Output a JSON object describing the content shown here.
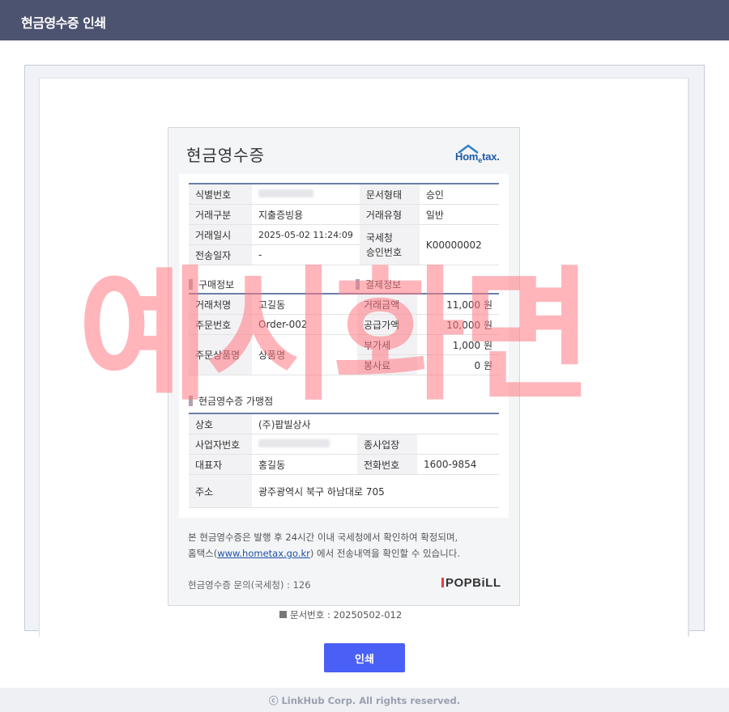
{
  "window": {
    "title": "현금영수증 인쇄"
  },
  "receipt": {
    "title": "현금영수증",
    "logo_text_a": "Hom",
    "logo_text_e": "e",
    "logo_text_b": "tax.",
    "basic": [
      {
        "label": "식별번호",
        "value": "010-****-1234",
        "blurred": true,
        "label2": "문서형태",
        "value2": "승인"
      },
      {
        "label": "거래구분",
        "value": "지출증빙용",
        "label2": "거래유형",
        "value2": "일반"
      },
      {
        "label": "거래일시",
        "value": "2025-05-02 11:24:09",
        "label2": "국세청\n승인번호",
        "value2": "K00000002"
      },
      {
        "label": "전송일자",
        "value": "-"
      }
    ],
    "buyer_section_title": "구매정보",
    "payment_section_title": "결제정보",
    "buyer": [
      {
        "label": "거래처명",
        "value": "고길동"
      },
      {
        "label": "주문번호",
        "value": "Order-002"
      },
      {
        "label": "주문상품명",
        "value": "상품명"
      }
    ],
    "payment": [
      {
        "label": "거래금액",
        "value": "11,000 원"
      },
      {
        "label": "공급가액",
        "value": "10,000 원"
      },
      {
        "label": "부가세",
        "value": "1,000 원"
      },
      {
        "label": "봉사료",
        "value": "0 원"
      }
    ],
    "merchant_section_title": "현금영수증 가맹점",
    "merchant": {
      "name_label": "상호",
      "name": "(주)팝빌상사",
      "bizno_label": "사업자번호",
      "bizno": "678-87-00400",
      "type_label": "종사업장",
      "type": "",
      "ceo_label": "대표자",
      "ceo": "홍길동",
      "tel_label": "전화번호",
      "tel": "1600-9854",
      "addr_label": "주소",
      "addr": "광주광역시 북구 하남대로 705"
    },
    "notice_line1": "본 현금영수증은 발행 후 24시간 이내 국세청에서 확인하여 확정되며,",
    "notice_line2_pre": "홈택스(",
    "notice_link": "www.hometax.go.kr",
    "notice_line2_post": ") 에서 전송내역을 확인할 수 있습니다.",
    "inquiry": "현금영수증 문의(국세청) : 126",
    "brand": "POPBiLL"
  },
  "doc_number": "문서번호 : 20250502-012",
  "watermark": "예시화면",
  "print_button": "인쇄",
  "footer": "ⓒ LinkHub Corp. All rights reserved.",
  "colors": {
    "titlebar": "#4c5370",
    "accent_button": "#4a5ff5",
    "table_rule": "#6b7fa8",
    "watermark": "#ff7882"
  }
}
